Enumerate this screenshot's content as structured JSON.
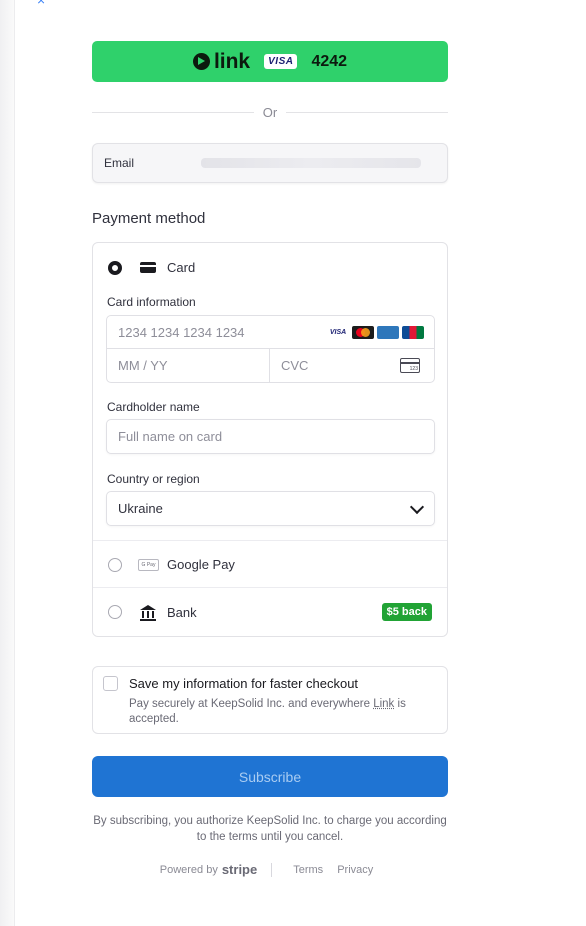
{
  "link": {
    "logo_text": "link",
    "card_brand": "VISA",
    "last4": "4242"
  },
  "divider": {
    "or_text": "Or"
  },
  "email": {
    "label": "Email"
  },
  "payment": {
    "title": "Payment method",
    "card_label": "Card",
    "card_info_label": "Card information",
    "card_number_placeholder": "1234 1234 1234 1234",
    "expiry_placeholder": "MM / YY",
    "cvc_placeholder": "CVC",
    "cvc_icon_text": "123",
    "brands": [
      "visa",
      "mastercard",
      "amex",
      "jcb"
    ],
    "visa_text": "VISA",
    "cardholder_label": "Cardholder name",
    "cardholder_placeholder": "Full name on card",
    "country_label": "Country or region",
    "country_value": "Ukraine",
    "gpay_label": "Google Pay",
    "gpay_icon_text": "G Pay",
    "bank_label": "Bank",
    "bank_badge": "$5 back"
  },
  "save": {
    "title": "Save my information for faster checkout",
    "desc_prefix": "Pay securely at KeepSolid Inc. and everywhere ",
    "desc_link": "Link",
    "desc_suffix": " is accepted."
  },
  "subscribe": {
    "label": "Subscribe"
  },
  "legal": {
    "text": "By subscribing, you authorize KeepSolid Inc. to charge you according to the terms until you cancel."
  },
  "footer": {
    "powered_by": "Powered by",
    "stripe": "stripe",
    "terms": "Terms",
    "privacy": "Privacy"
  },
  "colors": {
    "link_green": "#2fd16b",
    "primary_blue": "#1f74d3",
    "badge_green": "#21a335"
  }
}
